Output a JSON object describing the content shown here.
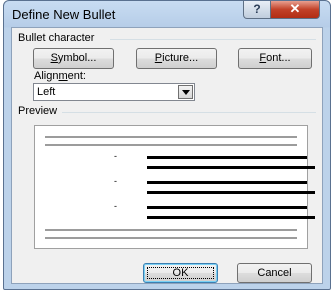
{
  "dialog": {
    "title": "Define New Bullet",
    "help_glyph": "?",
    "close_glyph": "✕"
  },
  "bullet_group": {
    "label": "Bullet character",
    "symbol_button": {
      "pre": "",
      "key": "S",
      "post": "ymbol..."
    },
    "picture_button": {
      "pre": "",
      "key": "P",
      "post": "icture..."
    },
    "font_button": {
      "pre": "",
      "key": "F",
      "post": "ont..."
    }
  },
  "alignment": {
    "label_pre": "Align",
    "label_key": "m",
    "label_post": "ent:",
    "value": "Left"
  },
  "preview": {
    "label": "Preview",
    "bullet_glyph": "-"
  },
  "footer": {
    "ok_label": "OK",
    "cancel_label": "Cancel"
  },
  "colors": {
    "title_bar": "#c8dcf2",
    "close_button": "#c24128",
    "client_bg": "#f0f0f0"
  }
}
